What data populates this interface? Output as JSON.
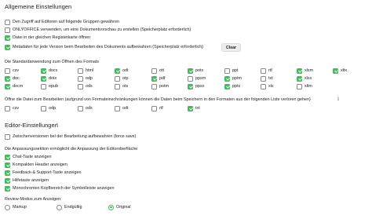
{
  "general": {
    "title": "Allgemeine Einstellungen",
    "options": [
      {
        "label": "Den Zugriff auf Editoren auf folgende Gruppen gewähren",
        "checked": false
      },
      {
        "label": "ONLYOFFICE verwenden, um eine Dokumentvorschau zu erstellen (Speicherplatz erforderlich)",
        "checked": false
      },
      {
        "label": "Datei in der gleichen Registerkarte öffnen",
        "checked": true
      },
      {
        "label": "Metadaten für jede Version beim Bearbeiten des Dokuments aufbewahren (Speicherplatz erforderlich)",
        "checked": true
      }
    ],
    "clear_label": "Clear"
  },
  "default_formats": {
    "label": "Die Standardanwendung zum Öffnen des Formats",
    "columns": [
      [
        {
          "ext": "csv",
          "checked": false
        },
        {
          "ext": "doc",
          "checked": true
        },
        {
          "ext": "docm",
          "checked": true
        }
      ],
      [
        {
          "ext": "docx",
          "checked": true
        },
        {
          "ext": "dotx",
          "checked": true
        },
        {
          "ext": "epub",
          "checked": false
        }
      ],
      [
        {
          "ext": "html",
          "checked": false
        },
        {
          "ext": "odp",
          "checked": false
        },
        {
          "ext": "ods",
          "checked": false
        }
      ],
      [
        {
          "ext": "odt",
          "checked": true
        },
        {
          "ext": "otp",
          "checked": false
        },
        {
          "ext": "ots",
          "checked": false
        }
      ],
      [
        {
          "ext": "ott",
          "checked": false
        },
        {
          "ext": "pdf",
          "checked": true
        },
        {
          "ext": "potm",
          "checked": false
        }
      ],
      [
        {
          "ext": "potx",
          "checked": true
        },
        {
          "ext": "ppsm",
          "checked": false
        },
        {
          "ext": "ppsx",
          "checked": true
        }
      ],
      [
        {
          "ext": "ppt",
          "checked": false
        },
        {
          "ext": "pptm",
          "checked": true
        },
        {
          "ext": "pptx",
          "checked": true
        }
      ],
      [
        {
          "ext": "rtf",
          "checked": false
        },
        {
          "ext": "txt",
          "checked": false
        },
        {
          "ext": "xls",
          "checked": false
        }
      ],
      [
        {
          "ext": "xlsm",
          "checked": true
        },
        {
          "ext": "xlsx",
          "checked": true
        },
        {
          "ext": "xltm",
          "checked": false
        }
      ],
      [
        {
          "ext": "xltx",
          "checked": true
        }
      ]
    ]
  },
  "edit_formats": {
    "label": "Öffne die Datei zum Bearbeiten (aufgrund von Formateinschränkungen können die Daten beim Speichern in den Formaten aus der folgenden Liste verloren gehen)",
    "items": [
      {
        "ext": "csv",
        "checked": false
      },
      {
        "ext": "odp",
        "checked": false
      },
      {
        "ext": "ods",
        "checked": false
      },
      {
        "ext": "odt",
        "checked": false
      },
      {
        "ext": "rtf",
        "checked": false
      },
      {
        "ext": "txt",
        "checked": true
      }
    ]
  },
  "editor": {
    "title": "Editor-Einstellungen",
    "force_save": {
      "label": "Zwischenversionen bei der Bearbeitung aufbewahren (force save)",
      "checked": false
    },
    "customization_label": "Die Anpassungssektion ermöglicht die Anpassung der Editoroberfläche",
    "customization_options": [
      {
        "label": "Chat-Taste anzeigen",
        "checked": true
      },
      {
        "label": "Kompakten Header anzeigen",
        "checked": true
      },
      {
        "label": "Feedback-& Support-Taste anzeigen",
        "checked": true
      },
      {
        "label": "Hilfetaste anzeigen",
        "checked": true
      },
      {
        "label": "Monochromen Kopfbereich der Symbolleiste anzeigen",
        "checked": true
      }
    ],
    "review_label": "Review-Modus zum Anzeigen:",
    "review_modes": [
      {
        "label": "Markup",
        "selected": false
      },
      {
        "label": "Endgültig",
        "selected": false
      },
      {
        "label": "Original",
        "selected": true
      }
    ]
  },
  "icons": {
    "info": "info-icon",
    "checkmark": "checkmark-icon"
  },
  "colors": {
    "accent": "#46ba61",
    "button_bg": "#ededed"
  }
}
